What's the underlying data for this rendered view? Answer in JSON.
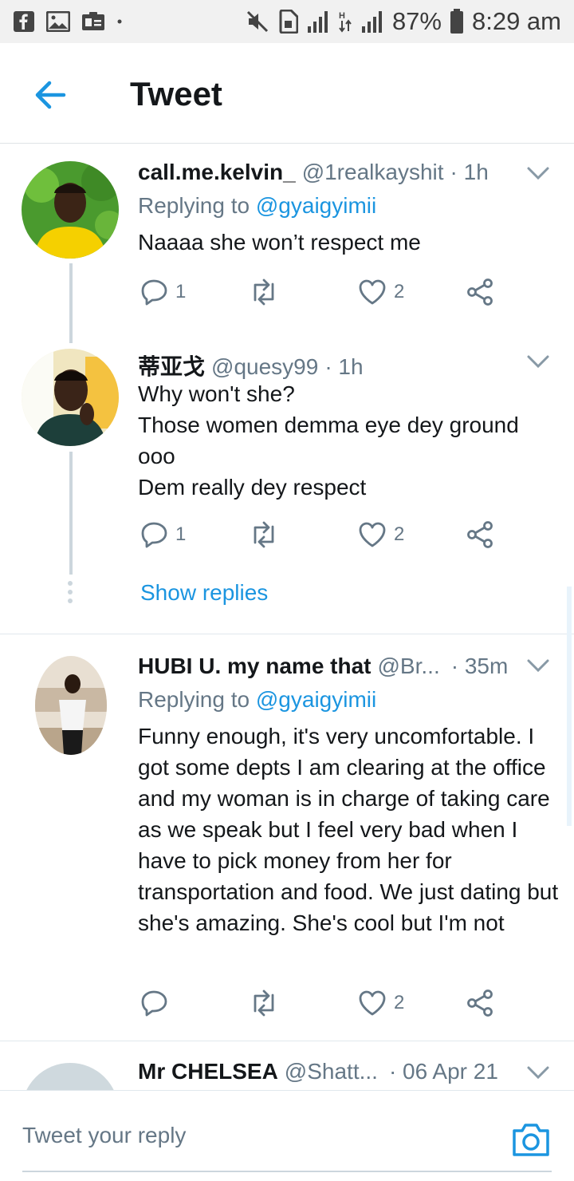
{
  "status_bar": {
    "battery": "87%",
    "time": "8:29 am",
    "icons": [
      "facebook-icon",
      "gallery-icon",
      "id-card-icon",
      "dot-icon",
      "mute-icon",
      "sim-icon",
      "signal-icon",
      "data-arrows-icon",
      "signal-icon",
      "battery-icon"
    ]
  },
  "header": {
    "title": "Tweet",
    "back_icon": "back-arrow-icon"
  },
  "tweets": [
    {
      "name": "call.me.kelvin_",
      "handle": "@1realkayshit",
      "time": "· 1h",
      "replying_prefix": "Replying to ",
      "replying_to": "@gyaigyimii",
      "text": "Naaaa she won’t respect me",
      "replies": "1",
      "retweets": "",
      "likes": "2"
    },
    {
      "name": "蒂亚戈",
      "handle": "@quesy99",
      "time": "· 1h",
      "text": "Why won't she?\nThose women demma eye dey ground ooo\nDem really dey respect",
      "replies": "1",
      "retweets": "",
      "likes": "2"
    },
    {
      "name": "HUBI U. my name that",
      "handle": "@Br...",
      "time": "· 35m",
      "replying_prefix": "Replying to ",
      "replying_to": "@gyaigyimii",
      "text": "Funny enough, it's very uncomfortable. I got some depts I am clearing at the office and my woman is in charge of taking care as we speak but I feel very bad when I have to pick money from her for transportation and food. We just dating but she's amazing. She's cool but I'm not",
      "replies": "",
      "retweets": "",
      "likes": "2"
    },
    {
      "name": "Mr CHELSEA",
      "handle": "@Shatt...",
      "time": "· 06 Apr 21"
    }
  ],
  "show_replies": "Show replies",
  "reply_bar": {
    "placeholder": "Tweet your reply",
    "camera_icon": "camera-icon"
  },
  "colors": {
    "accent": "#1b95e0",
    "secondary_text": "#657786",
    "text": "#14171a"
  }
}
